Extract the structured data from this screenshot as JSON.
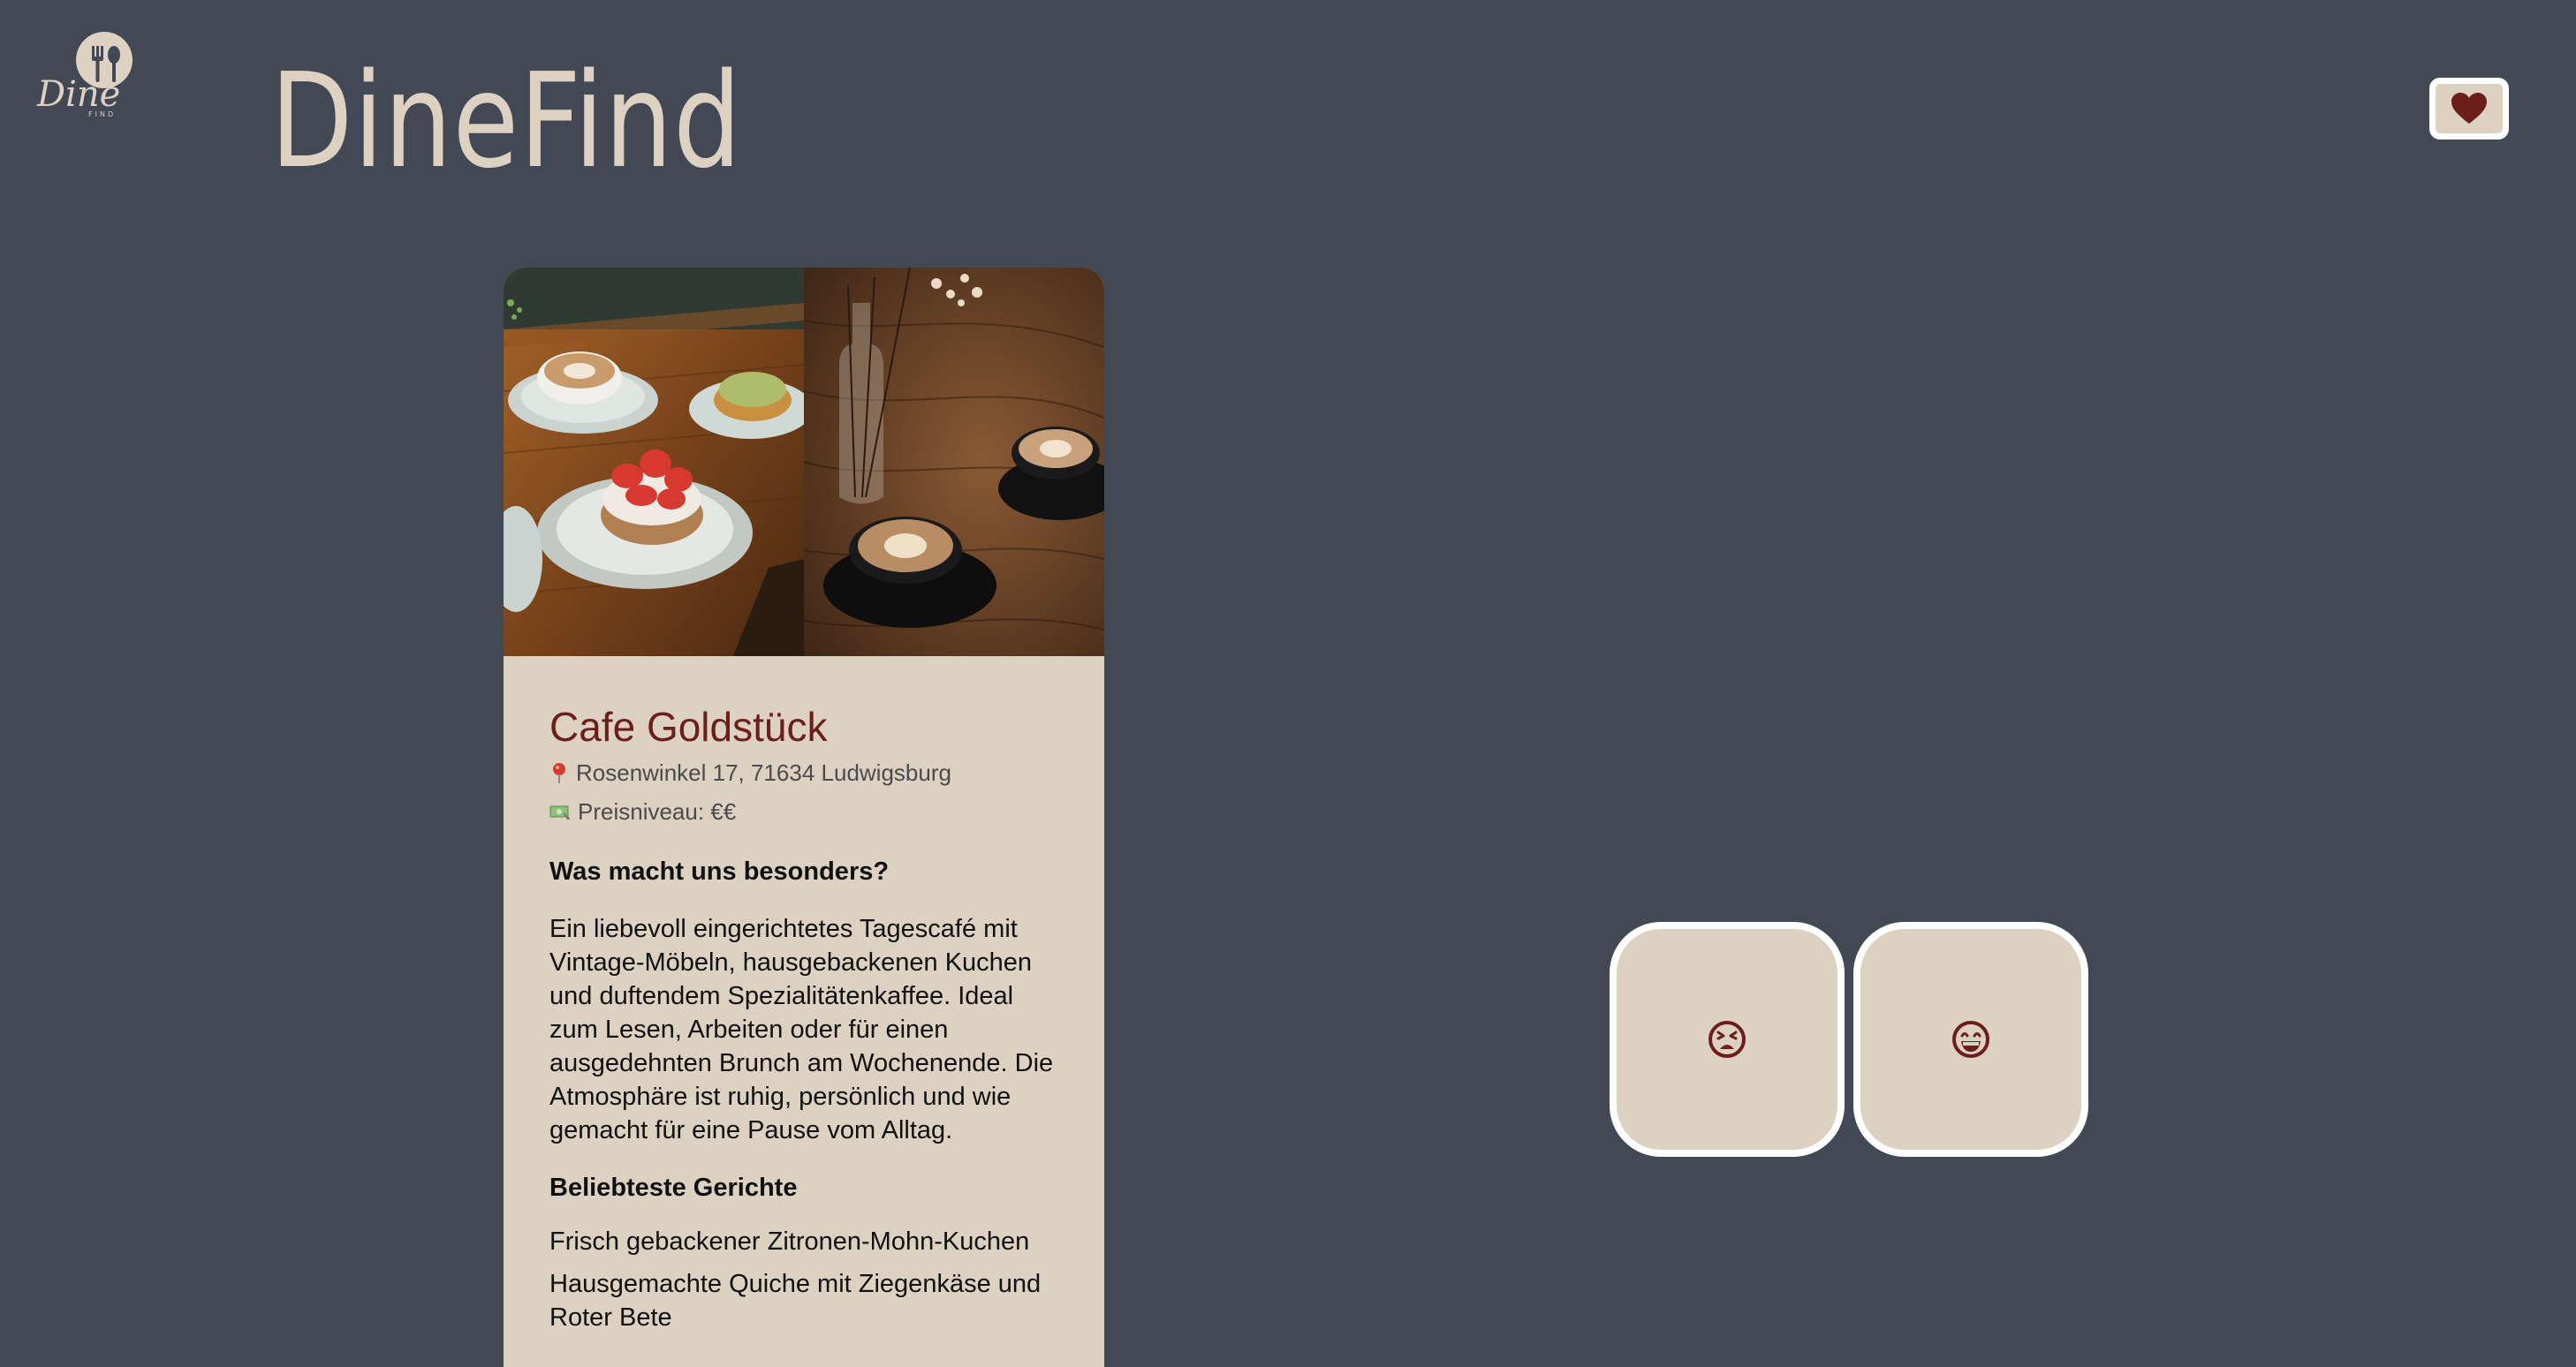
{
  "brand": {
    "logo_text": "Dine",
    "logo_subtext": "FIND",
    "title": "DineFind"
  },
  "icons": {
    "favorites": "heart-icon",
    "dislike": "tired-face-icon",
    "like": "grinning-face-icon",
    "location": "map-pin-icon",
    "price": "banknote-icon"
  },
  "colors": {
    "background": "#424854",
    "card": "#ddd1c1",
    "accent": "#6b1e1a",
    "border": "#ffffff"
  },
  "restaurant": {
    "name": "Cafe Goldstück",
    "address": "Rosenwinkel 17, 71634 Ludwigsburg",
    "price_level": "Preisniveau: €€",
    "special_heading": "Was macht uns besonders?",
    "description": "Ein liebevoll eingerichtetes Tagescafé mit Vintage-Möbeln, hausgebackenen Kuchen und duftendem Spezialitätenkaffee. Ideal zum Lesen, Arbeiten oder für einen ausgedehnten Brunch am Wochenende. Die Atmosphäre ist ruhig, persönlich und wie gemacht für eine Pause vom Alltag.",
    "dishes_heading": "Beliebteste Gerichte",
    "dishes": [
      "Frisch gebackener Zitronen-Mohn-Kuchen",
      "Hausgemachte Quiche mit Ziegenkäse und Roter Bete"
    ]
  }
}
